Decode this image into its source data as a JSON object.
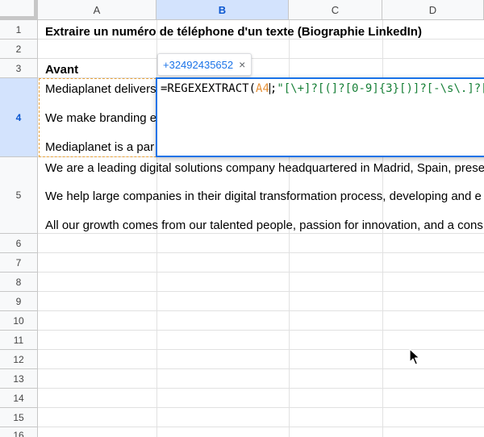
{
  "columns": [
    "A",
    "B",
    "C",
    "D"
  ],
  "rows": [
    "1",
    "2",
    "3",
    "4",
    "5",
    "6",
    "7",
    "8",
    "9",
    "10",
    "11",
    "12",
    "13",
    "14",
    "15",
    "16"
  ],
  "cells": {
    "a1": "Extraire un numéro de téléphone d'un texte (Biographie LinkedIn)",
    "a3": "Avant",
    "a4_line1": "Mediaplanet delivers",
    "a4_line2": "We make branding e",
    "a4_line3": "Mediaplanet is a par",
    "a5_line1": "We are a leading digital solutions company headquartered in Madrid, Spain, prese",
    "a5_line2": "We help large companies in their digital transformation process, developing and e",
    "a5_line3": "All our growth comes from our talented people, passion for innovation, and a cons"
  },
  "editor": {
    "prefix": "=REGEXEXTRACT(",
    "ref": "A4",
    "sep": ";",
    "pattern": "\"[\\+]?[(]?[0-9]{3}[)]?[-\\s\\.]?[0"
  },
  "tooltip": {
    "value": "+32492435652",
    "close": "×"
  },
  "colors": {
    "selected_header": "#d3e3fd",
    "accent": "#1a73e8",
    "copy_border": "#e8a33d"
  }
}
